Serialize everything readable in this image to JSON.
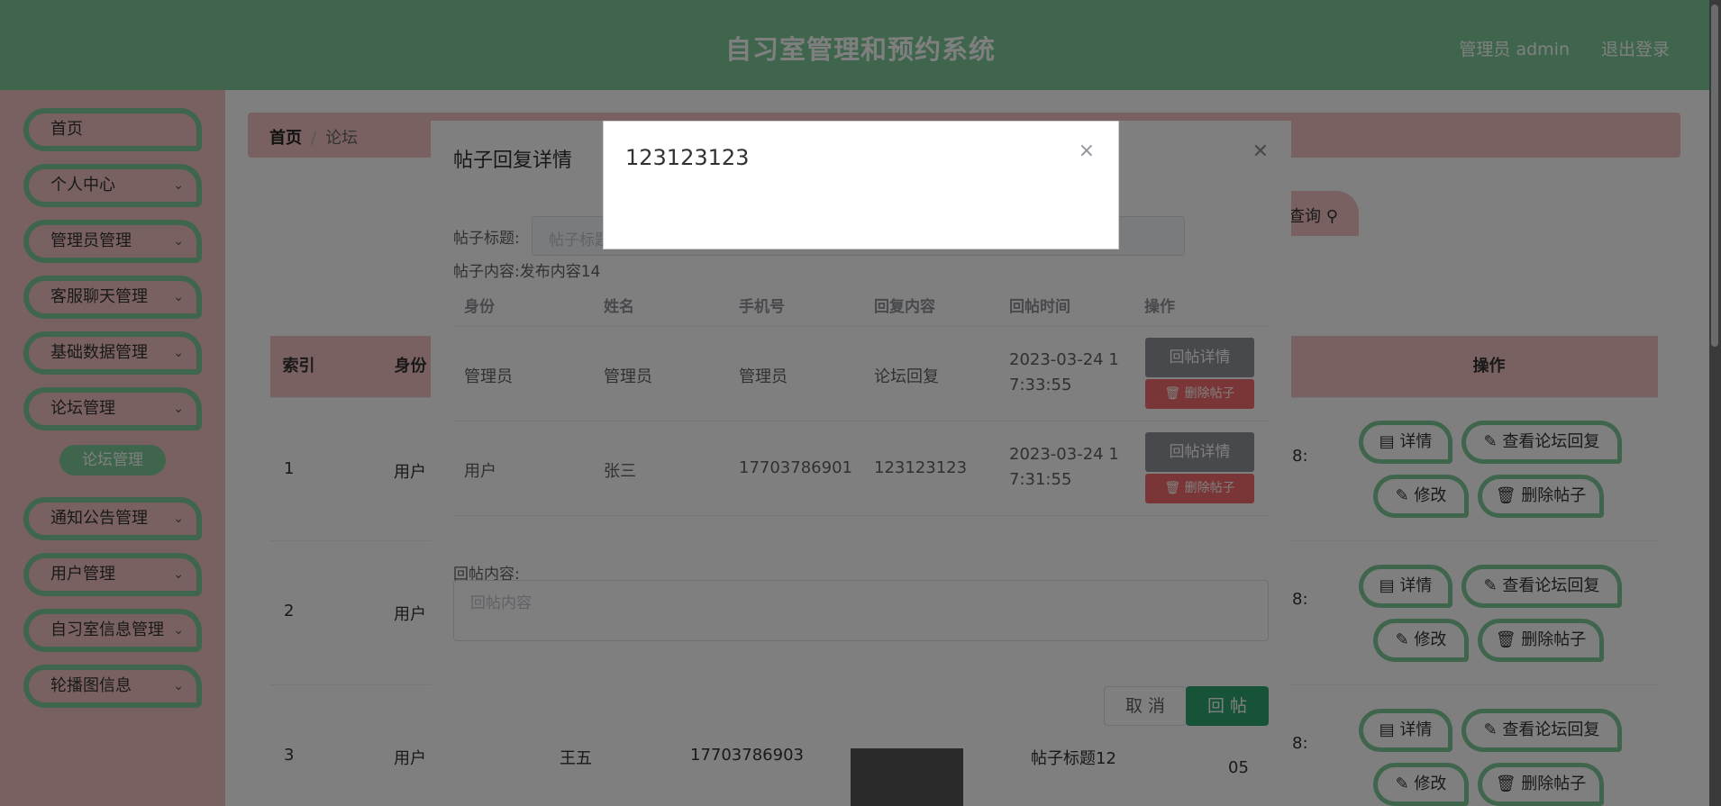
{
  "header": {
    "title": "自习室管理和预约系统",
    "user": "管理员 admin",
    "logout": "退出登录"
  },
  "sidebar": {
    "items": [
      {
        "label": "首页",
        "chevron": false
      },
      {
        "label": "个人中心",
        "chevron": true
      },
      {
        "label": "管理员管理",
        "chevron": true
      },
      {
        "label": "客服聊天管理",
        "chevron": true
      },
      {
        "label": "基础数据管理",
        "chevron": true
      },
      {
        "label": "论坛管理",
        "chevron": true
      },
      {
        "label": "通知公告管理",
        "chevron": true
      },
      {
        "label": "用户管理",
        "chevron": true
      },
      {
        "label": "自习室信息管理",
        "chevron": true
      },
      {
        "label": "轮播图信息",
        "chevron": true
      }
    ],
    "sub": "论坛管理"
  },
  "breadcrumb": {
    "home": "首页",
    "sep": "/",
    "current": "论坛"
  },
  "search": {
    "label": "查询 ⚲"
  },
  "table": {
    "headers": {
      "index": "索引",
      "role": "身份",
      "ops": "操作"
    },
    "rows": [
      {
        "index": "1",
        "role": "用户",
        "time_tail": "8:"
      },
      {
        "index": "2",
        "role": "用户",
        "time_tail": "8:"
      },
      {
        "index": "3",
        "role": "用户",
        "name": "王五",
        "phone": "17703786903",
        "title": "帖子标题12",
        "time_tail": "8:",
        "time_tail2": "05"
      }
    ],
    "btn": {
      "detail": "详情",
      "replies": "查看论坛回复",
      "edit": "修改",
      "delete": "删除帖子"
    }
  },
  "dialog": {
    "title": "帖子回复详情",
    "post_title_label": "帖子标题:",
    "post_title_placeholder": "帖子标题",
    "post_content_label": "帖子内容:",
    "post_content_value": "发布内容14",
    "columns": [
      "身份",
      "姓名",
      "手机号",
      "回复内容",
      "回帖时间",
      "操作"
    ],
    "rows": [
      {
        "role": "管理员",
        "name": "管理员",
        "phone": "管理员",
        "content": "论坛回复",
        "time1": "2023-03-24 1",
        "time2": "7:33:55"
      },
      {
        "role": "用户",
        "name": "张三",
        "phone": "17703786901",
        "content": "123123123",
        "time1": "2023-03-24 1",
        "time2": "7:31:55"
      }
    ],
    "btn_detail": "回帖详情",
    "btn_delete": "删除帖子",
    "reply_label": "回帖内容:",
    "reply_placeholder": "回帖内容",
    "cancel": "取 消",
    "reply": "回 帖"
  },
  "modal": {
    "text": "123123123",
    "close": "×"
  },
  "colors": {
    "green": "#7fcc9a",
    "pink": "#f4c2c2",
    "reply_green": "#2fa770",
    "danger": "#f56c6c"
  }
}
